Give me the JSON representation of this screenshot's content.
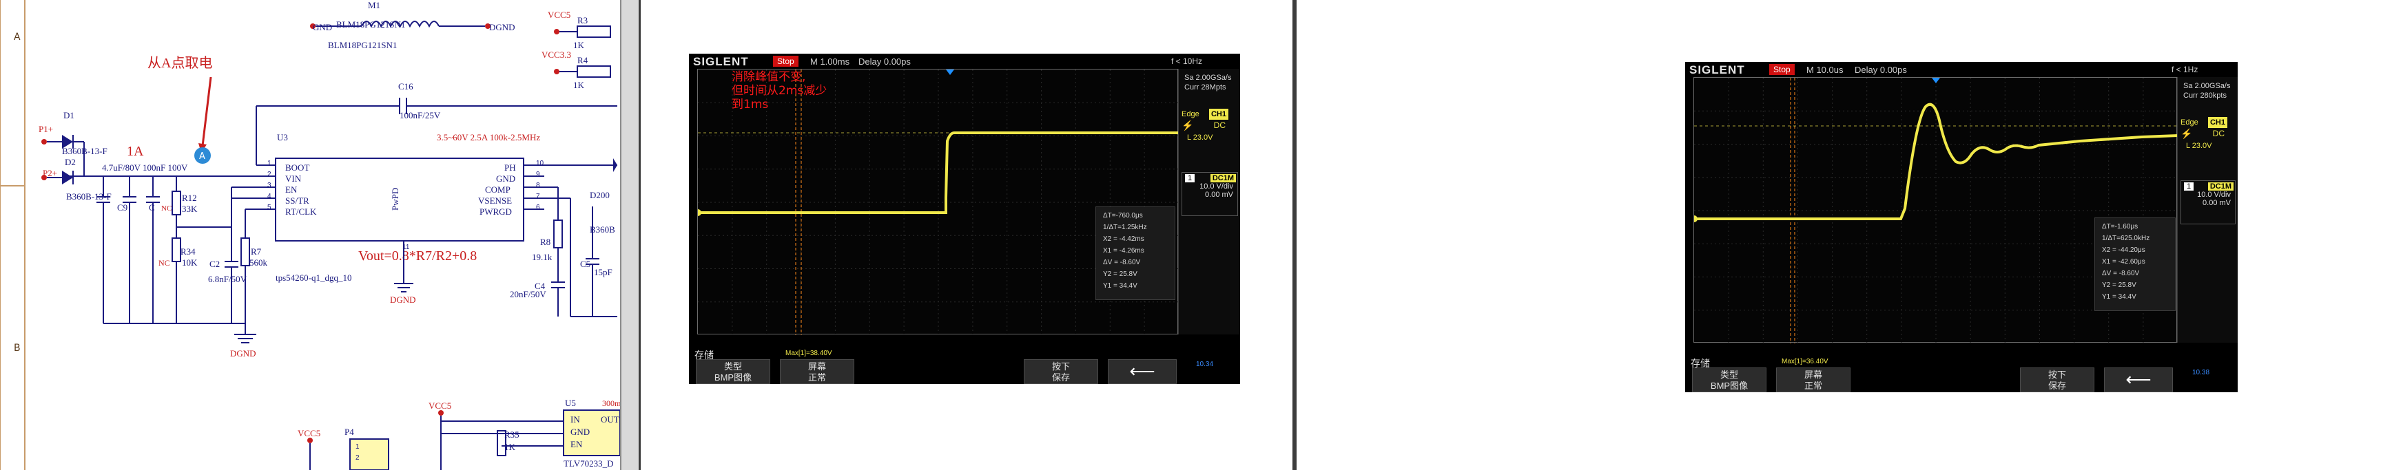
{
  "schematic": {
    "row_labels": [
      "A",
      "B"
    ],
    "annotation": "从A点取电",
    "point_label": "A",
    "current_label": "1A",
    "ic": {
      "ref": "U3",
      "spec": "3.5~60V 2.5A 100k-2.5MHz",
      "part": "tps54260-q1_dgq_10",
      "pins_left": [
        "BOOT",
        "VIN",
        "EN",
        "SS/TR",
        "RT/CLK"
      ],
      "pins_left_num": [
        "1",
        "2",
        "3",
        "4",
        "5"
      ],
      "pins_right": [
        "PH",
        "GND",
        "COMP",
        "VSENSE",
        "PWRGD"
      ],
      "pins_right_num": [
        "10",
        "9",
        "8",
        "7",
        "6"
      ],
      "pad": "PwPD",
      "pad_num": "11"
    },
    "formula": "Vout=0.8*R7/R2+0.8",
    "labels": {
      "m1": "M1",
      "bead": "BLM18PG121SN1",
      "bead2": "BLM18PG121SN1",
      "gnd": "GND",
      "dgnd": "DGND",
      "dgnd2": "DGND",
      "dgnd3": "DGND",
      "vcc5": "VCC5",
      "vcc33": "VCC3.3",
      "r3": "R3",
      "r3v": "1K",
      "r4": "R4",
      "r4v": "1K",
      "c16": "C16",
      "c16v": "100nF/25V",
      "d1": "D1",
      "d1p": "B360B-13-F",
      "d2": "D2",
      "d2p": "B360B-13-F",
      "p1": "P1+",
      "p2": "P2+",
      "cap_row": "4.7uF/80V 100nF 100V",
      "c9": "C9",
      "c10": "C",
      "r12": "R12",
      "r12v": "33K",
      "nc": "NC",
      "nc2": "NC",
      "r34": "R34",
      "r34v": "10K",
      "c2": "C2",
      "c2v": "6.8nF/50V",
      "r7": "R7",
      "r7v": "560k",
      "r8": "R8",
      "r8v": "19.1k",
      "c4": "C4",
      "c4v": "20nF/50V",
      "d200": "D200",
      "b360": "B360B",
      "c5": "C5",
      "c5v": "15pF",
      "p4": "P4",
      "vcc5b": "VCC5",
      "vcc5c": "VCC5",
      "r35": "R35",
      "r35v": "1K",
      "u5": "U5",
      "u5v": "300mA",
      "u5_in": "IN",
      "u5_gnd": "GND",
      "u5_en": "EN",
      "u5_out": "OUT",
      "u5_part": "TLV70233_D",
      "p4_1": "1",
      "p4_2": "2"
    }
  },
  "scope1": {
    "brand": "SIGLENT",
    "run_state": "Stop",
    "timebase": "M 1.00ms",
    "delay": "Delay 0.00ps",
    "trig_freq": "f < 10Hz",
    "sample_rate": "Sa 2.00GSa/s",
    "curr": "Curr 28Mpts",
    "edge_label": "Edge",
    "edge_src": "CH1",
    "coupling": "DC",
    "trig_level": "L  23.0V",
    "ch_num": "1",
    "ch_coupling": "DC1M",
    "volts_div": "10.0 V/div",
    "offset": "0.00 mV",
    "annotation": [
      "消除峰值不变,",
      "但时间从2ms减少",
      "到1ms"
    ],
    "measurements": [
      "ΔT=-760.0μs",
      "1/ΔT=1.25kHz",
      "X2 = -4.42ms",
      "X1 = -4.26ms",
      "ΔV = -8.60V",
      "Y2 = 25.8V",
      "Y1 = 34.4V"
    ],
    "max_readout": "Max[1]=38.40V",
    "footer_title": "存储",
    "btn1": [
      "类型",
      "BMP图像"
    ],
    "btn2": [
      "屏幕",
      "正常"
    ],
    "btn3": [
      "按下",
      "保存"
    ],
    "back_symbol": "⟵",
    "corner": "10.34"
  },
  "scope2": {
    "brand": "SIGLENT",
    "run_state": "Stop",
    "timebase": "M 10.0us",
    "delay": "Delay 0.00ps",
    "trig_freq": "f < 1Hz",
    "sample_rate": "Sa 2.00GSa/s",
    "curr": "Curr 280kpts",
    "edge_label": "Edge",
    "edge_src": "CH1",
    "coupling": "DC",
    "trig_level": "L  23.0V",
    "ch_num": "1",
    "ch_coupling": "DC1M",
    "volts_div": "10.0 V/div",
    "offset": "0.00 mV",
    "measurements": [
      "ΔT=-1.60μs",
      "1/ΔT=625.0kHz",
      "X2 = -44.20μs",
      "X1 = -42.60μs",
      "ΔV = -8.60V",
      "Y2 = 25.8V",
      "Y1 = 34.4V"
    ],
    "max_readout": "Max[1]=36.40V",
    "footer_title": "存储",
    "btn1": [
      "类型",
      "BMP图像"
    ],
    "btn2": [
      "屏幕",
      "正常"
    ],
    "btn3": [
      "按下",
      "保存"
    ],
    "back_symbol": "⟵",
    "corner": "10.38"
  },
  "colors": {
    "trace": "#f0e84a",
    "annotation": "#ff1a1a",
    "wire": "#1a1a80",
    "bg": "#000000"
  }
}
